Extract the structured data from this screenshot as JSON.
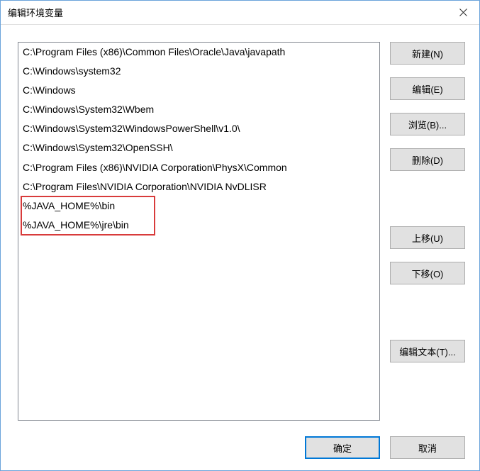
{
  "window": {
    "title": "编辑环境变量"
  },
  "list": {
    "items": [
      "C:\\Program Files (x86)\\Common Files\\Oracle\\Java\\javapath",
      "C:\\Windows\\system32",
      "C:\\Windows",
      "C:\\Windows\\System32\\Wbem",
      "C:\\Windows\\System32\\WindowsPowerShell\\v1.0\\",
      "C:\\Windows\\System32\\OpenSSH\\",
      "C:\\Program Files (x86)\\NVIDIA Corporation\\PhysX\\Common",
      "C:\\Program Files\\NVIDIA Corporation\\NVIDIA NvDLISR",
      "%JAVA_HOME%\\bin",
      "%JAVA_HOME%\\jre\\bin"
    ],
    "highlight_range": [
      8,
      9
    ]
  },
  "buttons": {
    "new": "新建(N)",
    "edit": "编辑(E)",
    "browse": "浏览(B)...",
    "delete": "删除(D)",
    "moveup": "上移(U)",
    "movedown": "下移(O)",
    "edittext": "编辑文本(T)...",
    "ok": "确定",
    "cancel": "取消"
  }
}
